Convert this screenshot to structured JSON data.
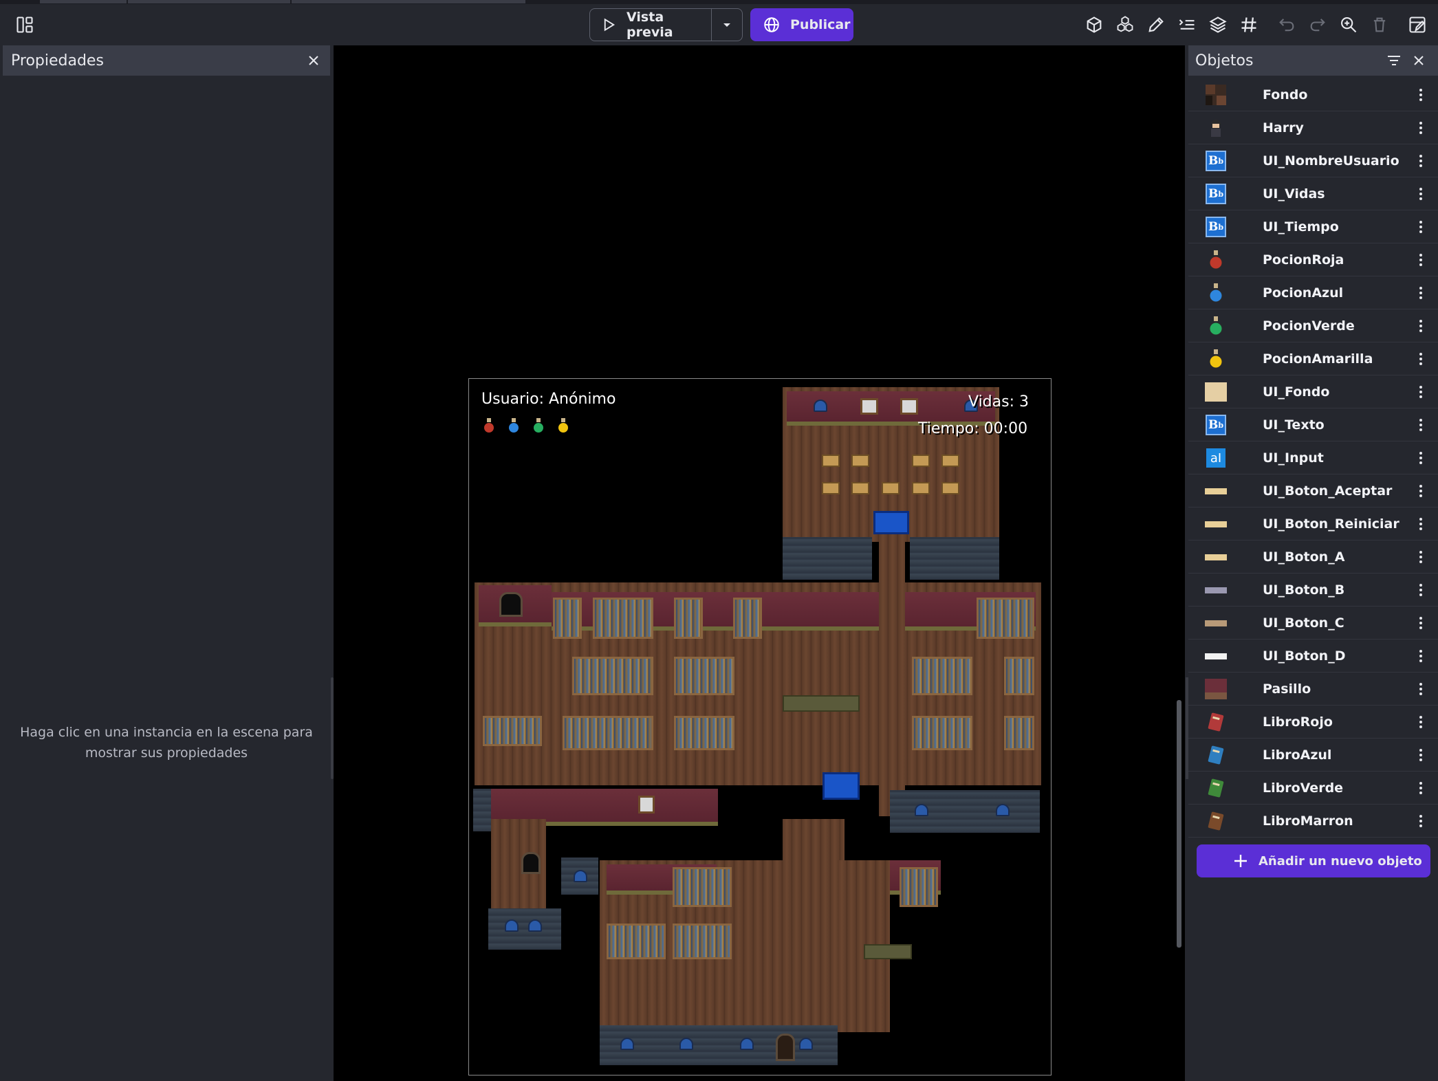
{
  "toolbar": {
    "preview_label": "Vista previa",
    "publish_label": "Publicar"
  },
  "properties": {
    "title": "Propiedades",
    "empty_line1": "Haga clic en una instancia en la escena para",
    "empty_line2": "mostrar sus propiedades"
  },
  "scene": {
    "hud_user": "Usuario: Anónimo",
    "hud_lives": "Vidas: 3",
    "hud_time": "Tiempo: 00:00"
  },
  "objects": {
    "title": "Objetos",
    "add_label": "Añadir un nuevo objeto",
    "items": [
      {
        "name": "Fondo",
        "thumb": "tilemap"
      },
      {
        "name": "Harry",
        "thumb": "character"
      },
      {
        "name": "UI_NombreUsuario",
        "thumb": "text-bb"
      },
      {
        "name": "UI_Vidas",
        "thumb": "text-bb"
      },
      {
        "name": "UI_Tiempo",
        "thumb": "text-bb"
      },
      {
        "name": "PocionRoja",
        "thumb": "potion",
        "color": "#c0392b"
      },
      {
        "name": "PocionAzul",
        "thumb": "potion",
        "color": "#2e86de"
      },
      {
        "name": "PocionVerde",
        "thumb": "potion",
        "color": "#27ae60"
      },
      {
        "name": "PocionAmarilla",
        "thumb": "potion",
        "color": "#f1c40f"
      },
      {
        "name": "UI_Fondo",
        "thumb": "parchment"
      },
      {
        "name": "UI_Texto",
        "thumb": "text-bb"
      },
      {
        "name": "UI_Input",
        "thumb": "text-input"
      },
      {
        "name": "UI_Boton_Aceptar",
        "thumb": "bar",
        "color": "#e8cf98"
      },
      {
        "name": "UI_Boton_Reiniciar",
        "thumb": "bar",
        "color": "#e8cf98"
      },
      {
        "name": "UI_Boton_A",
        "thumb": "bar",
        "color": "#e8cf98"
      },
      {
        "name": "UI_Boton_B",
        "thumb": "bar",
        "color": "#9a98b0"
      },
      {
        "name": "UI_Boton_C",
        "thumb": "bar",
        "color": "#b89a78"
      },
      {
        "name": "UI_Boton_D",
        "thumb": "bar",
        "color": "#f2f2f2"
      },
      {
        "name": "Pasillo",
        "thumb": "wall"
      },
      {
        "name": "LibroRojo",
        "thumb": "book",
        "color": "#b23a3a"
      },
      {
        "name": "LibroAzul",
        "thumb": "book",
        "color": "#2f7fc0"
      },
      {
        "name": "LibroVerde",
        "thumb": "book",
        "color": "#3f8a3a"
      },
      {
        "name": "LibroMarron",
        "thumb": "book",
        "color": "#7a4a2a"
      }
    ]
  }
}
